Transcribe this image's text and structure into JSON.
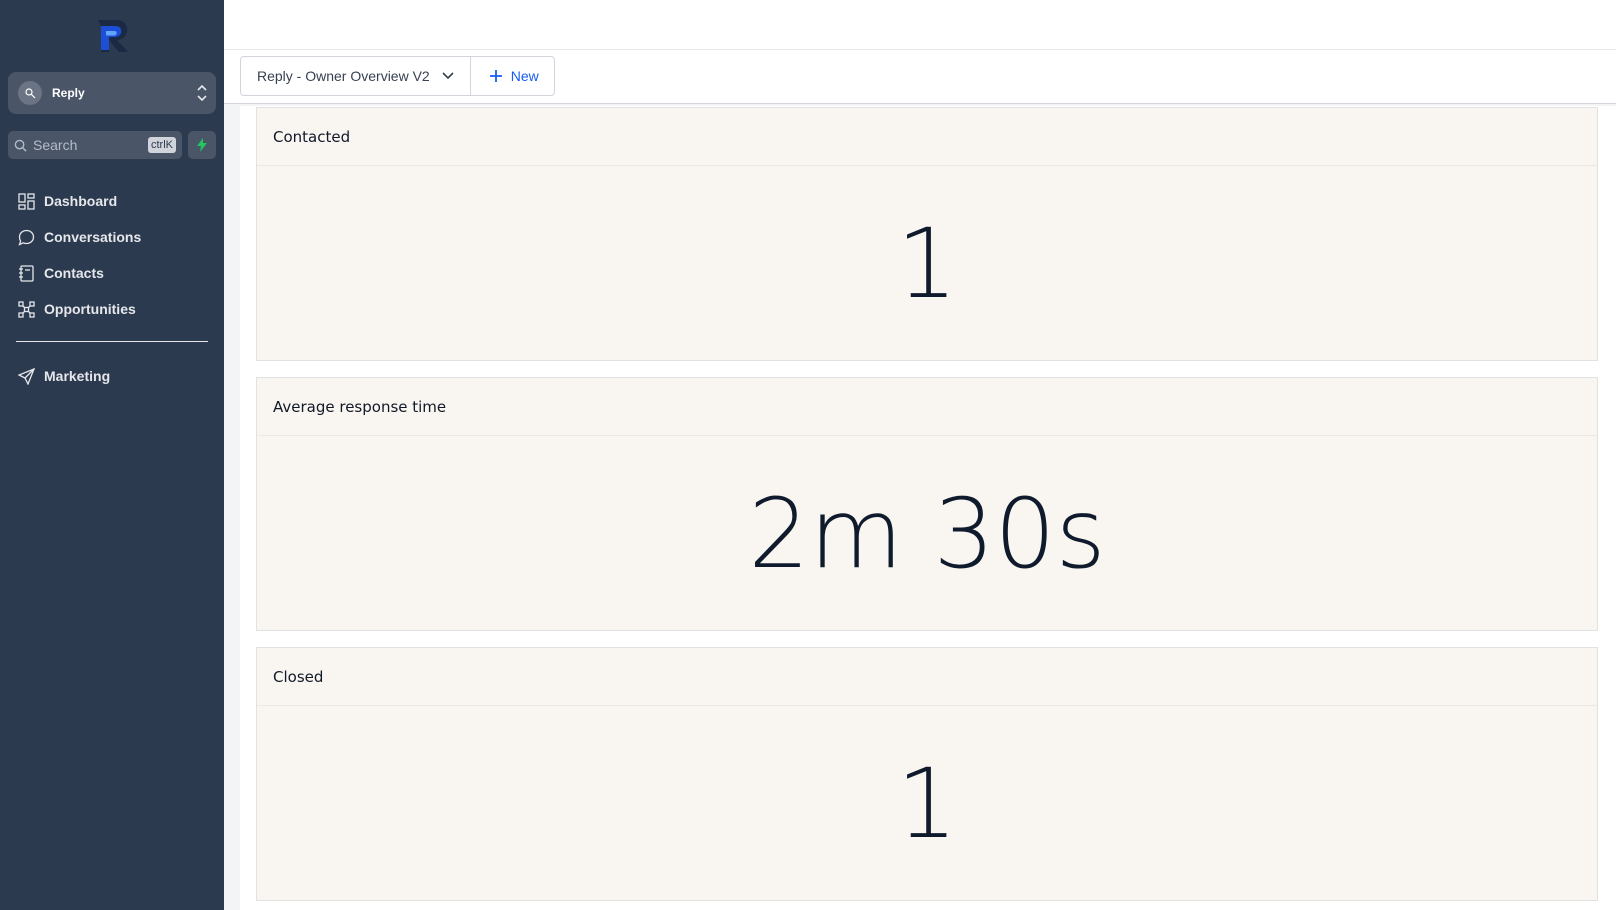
{
  "sidebar": {
    "account": {
      "name": "Reply"
    },
    "search": {
      "placeholder": "Search",
      "shortcut": "ctrlK"
    },
    "nav": [
      {
        "label": "Dashboard",
        "icon": "grid-icon"
      },
      {
        "label": "Conversations",
        "icon": "chat-icon"
      },
      {
        "label": "Contacts",
        "icon": "contacts-book-icon"
      },
      {
        "label": "Opportunities",
        "icon": "network-icon"
      }
    ],
    "nav2": [
      {
        "label": "Marketing",
        "icon": "send-icon"
      }
    ]
  },
  "toolbar": {
    "dashboard_name": "Reply - Owner Overview V2",
    "new_label": "New"
  },
  "cards": [
    {
      "title": "Contacted",
      "value": "1"
    },
    {
      "title": "Average response time",
      "value": "2m 30s"
    },
    {
      "title": "Closed",
      "value": "1"
    }
  ],
  "colors": {
    "sidebar_bg": "#2c3a4f",
    "accent_blue": "#155eef",
    "card_bg": "#f9f6f1",
    "bolt_green": "#22c55e"
  }
}
